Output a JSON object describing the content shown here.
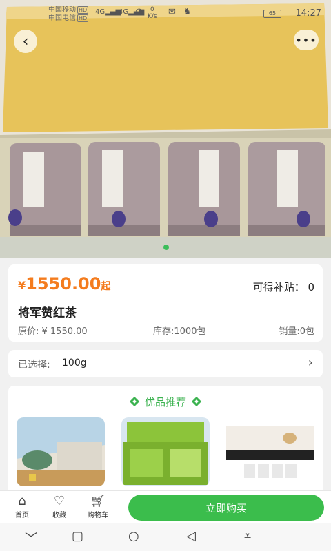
{
  "status": {
    "carrier1": "中国移动",
    "carrier2": "中国电信",
    "hd": "HD",
    "sig1": "4G",
    "sig2": "4G",
    "speed_num": "0",
    "speed_unit": "K/s",
    "battery": "65",
    "time": "14:27"
  },
  "product": {
    "price_symbol": "¥",
    "price": "1550.00",
    "price_suffix": "起",
    "subsidy": "可得补贴： 0",
    "name": "将军赞红茶",
    "original_price": "原价: ¥ 1550.00",
    "stock": "库存:1000包",
    "sales": "销量:0包"
  },
  "selection": {
    "label": "已选择:",
    "value": "100g"
  },
  "recommend": {
    "title": "优品推荐"
  },
  "bottom": {
    "home": "首页",
    "favorite": "收藏",
    "cart": "购物车",
    "buy": "立即购买"
  },
  "colors": {
    "accent_green": "#3bbd4c",
    "price_orange": "#f47c1e"
  },
  "icons": [
    "back-icon",
    "more-icon",
    "home-icon",
    "heart-icon",
    "cart-icon",
    "chevron-right-icon"
  ]
}
